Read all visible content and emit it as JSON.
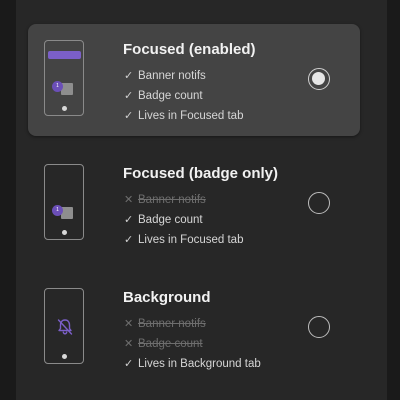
{
  "options": [
    {
      "title": "Focused (enabled)",
      "selected": true,
      "badge_text": "1",
      "features": [
        {
          "label": "Banner notifs",
          "mark": "✓",
          "enabled": true
        },
        {
          "label": "Badge count",
          "mark": "✓",
          "enabled": true
        },
        {
          "label": "Lives in Focused tab",
          "mark": "✓",
          "enabled": true
        }
      ]
    },
    {
      "title": "Focused (badge only)",
      "selected": false,
      "badge_text": "1",
      "features": [
        {
          "label": "Banner notifs",
          "mark": "✕",
          "enabled": false
        },
        {
          "label": "Badge count",
          "mark": "✓",
          "enabled": true
        },
        {
          "label": "Lives in Focused tab",
          "mark": "✓",
          "enabled": true
        }
      ]
    },
    {
      "title": "Background",
      "selected": false,
      "features": [
        {
          "label": "Banner notifs",
          "mark": "✕",
          "enabled": false
        },
        {
          "label": "Badge count",
          "mark": "✕",
          "enabled": false
        },
        {
          "label": "Lives in Background tab",
          "mark": "✓",
          "enabled": true
        }
      ]
    }
  ],
  "colors": {
    "accent": "#7b5fc8",
    "selected_card": "#444444",
    "panel": "#272727"
  },
  "icons": {
    "enabled_mark": "check-icon",
    "disabled_mark": "x-icon",
    "background_illustration": "bell-off-icon"
  }
}
